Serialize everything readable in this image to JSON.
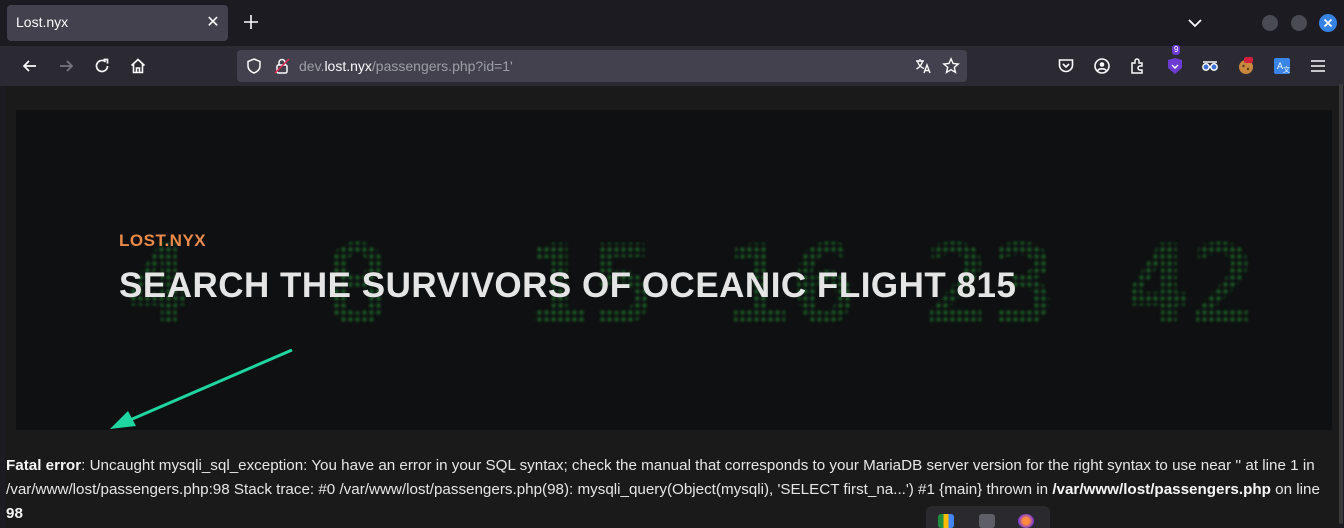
{
  "browser": {
    "tab": {
      "title": "Lost.nyx"
    },
    "url": {
      "prefix": "dev.",
      "host": "lost.nyx",
      "path": "/passengers.php?id=1'"
    },
    "extension_badge": "9"
  },
  "hero": {
    "site_label": "LOST.NYX",
    "title": "SEARCH THE SURVIVORS OF OCEANIC FLIGHT 815",
    "background_numbers": [
      "4",
      "8",
      "15",
      "16",
      "23",
      "42"
    ]
  },
  "error": {
    "label": "Fatal error",
    "message": ": Uncaught mysqli_sql_exception: You have an error in your SQL syntax; check the manual that corresponds to your MariaDB server version for the right syntax to use near '' at line 1 in /var/www/lost/passengers.php:98 Stack trace: #0 /var/www/lost/passengers.php(98): mysqli_query(Object(mysqli), 'SELECT first_na...') #1 {main} thrown in ",
    "file": "/var/www/lost/passengers.php",
    "on_line": " on line ",
    "line": "98"
  },
  "colors": {
    "accent_orange": "#e88a4a",
    "glow_green": "#1f7a2e",
    "arrow": "#1fd6a0"
  }
}
